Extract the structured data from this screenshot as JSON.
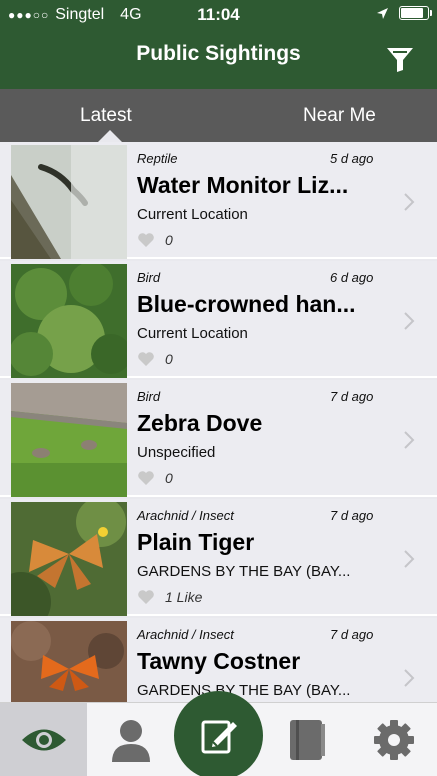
{
  "status_bar": {
    "carrier": "Singtel",
    "network": "4G",
    "time": "11:04",
    "battery_level": 0.85
  },
  "nav": {
    "title": "Public Sightings",
    "filter_icon": "funnel-icon"
  },
  "tabs": [
    {
      "label": "Latest",
      "selected": true
    },
    {
      "label": "Near Me",
      "selected": false
    }
  ],
  "sightings": [
    {
      "category": "Reptile",
      "ago": "5 d ago",
      "name": "Water Monitor Liz...",
      "location": "Current Location",
      "likes": "0"
    },
    {
      "category": "Bird",
      "ago": "6 d ago",
      "name": "Blue-crowned han...",
      "location": "Current Location",
      "likes": "0"
    },
    {
      "category": "Bird",
      "ago": "7 d ago",
      "name": "Zebra Dove",
      "location": "Unspecified",
      "likes": "0"
    },
    {
      "category": "Arachnid / Insect",
      "ago": "7 d ago",
      "name": "Plain Tiger",
      "location": "GARDENS BY THE BAY (BAY...",
      "likes": "1 Like"
    },
    {
      "category": "Arachnid / Insect",
      "ago": "7 d ago",
      "name": "Tawny Costner",
      "location": "GARDENS BY THE BAY (BAY...",
      "likes": ""
    }
  ],
  "tab_bar": [
    {
      "icon": "eye-icon",
      "selected": true
    },
    {
      "icon": "person-icon",
      "selected": false
    },
    {
      "icon": "compose-icon",
      "selected": false
    },
    {
      "icon": "notebook-icon",
      "selected": false
    },
    {
      "icon": "gear-icon",
      "selected": false
    }
  ],
  "colors": {
    "brand_green": "#2e5a32",
    "tab_gray": "#5a5a5a"
  }
}
